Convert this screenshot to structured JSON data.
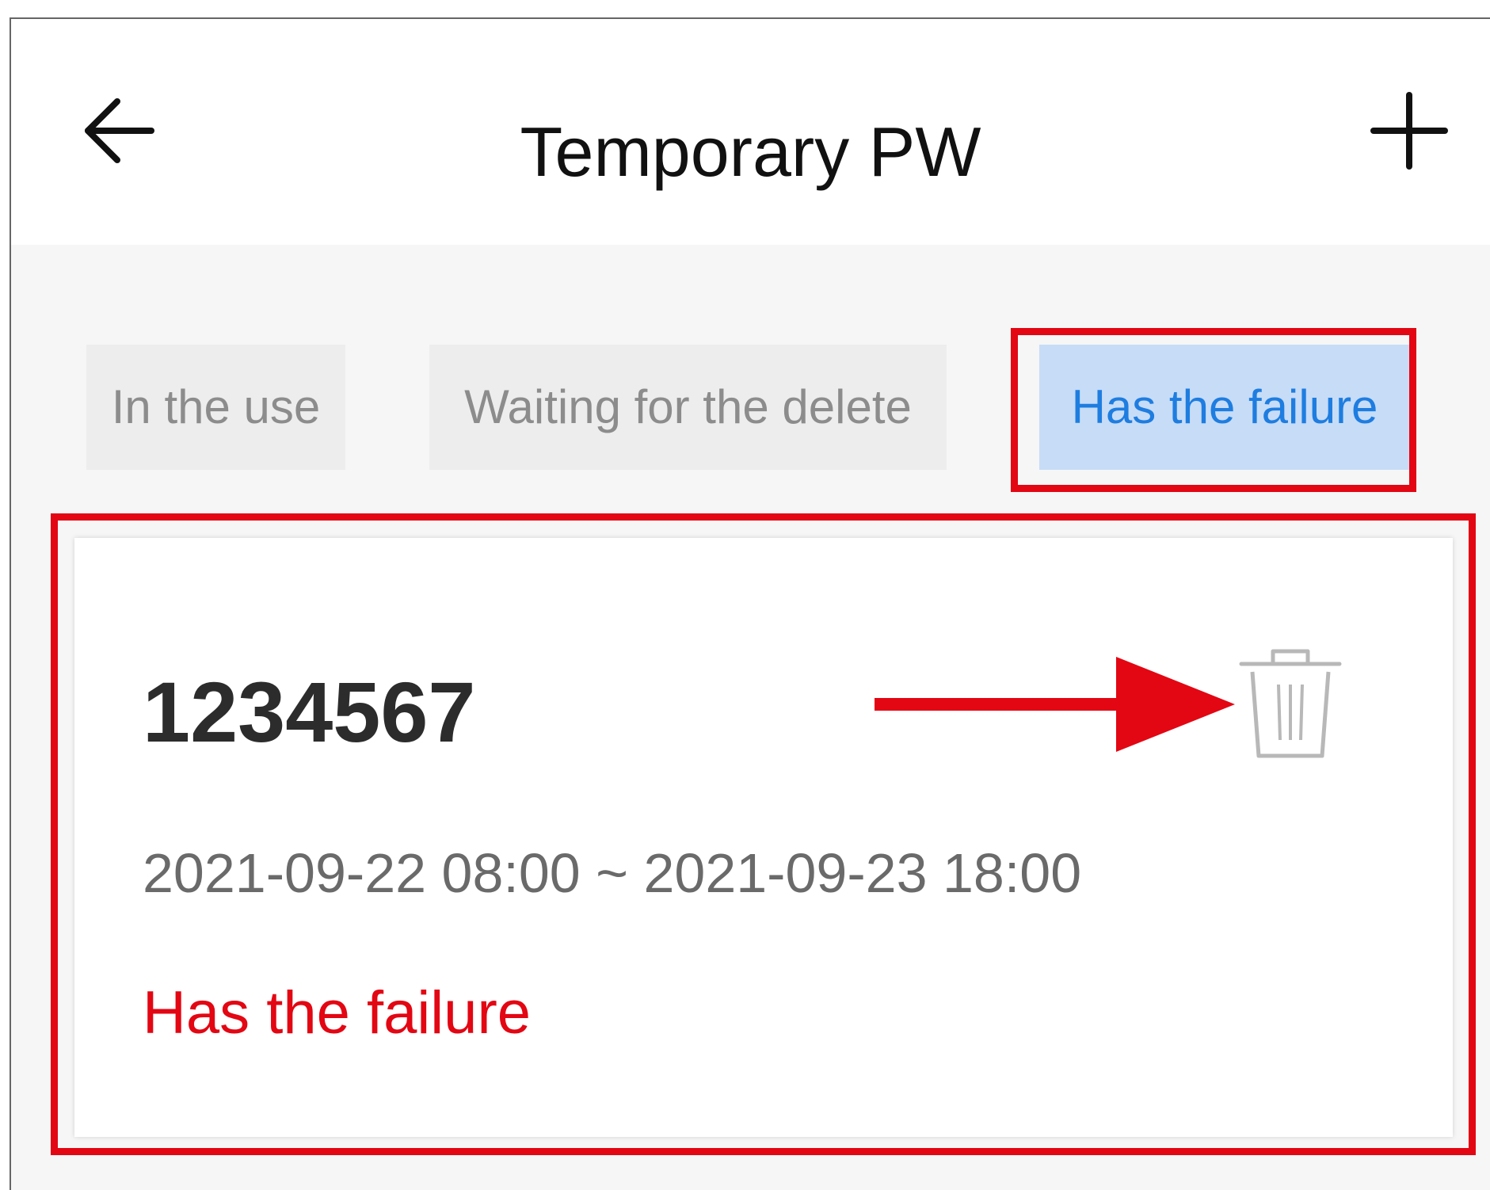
{
  "header": {
    "title": "Temporary PW",
    "back_icon": "back-arrow-icon",
    "add_icon": "plus-icon"
  },
  "tabs": [
    {
      "label": "In the use",
      "active": false
    },
    {
      "label": "Waiting for the delete",
      "active": false
    },
    {
      "label": "Has the failure",
      "active": true
    }
  ],
  "password_card": {
    "number": "1234567",
    "validity": "2021-09-22 08:00 ~ 2021-09-23 18:00",
    "status": "Has the failure",
    "delete_icon": "trash-icon"
  },
  "colors": {
    "active_tab_bg": "#c7dcf7",
    "active_tab_text": "#1e7de0",
    "status_failure": "#e30613",
    "highlight": "#e30613"
  }
}
